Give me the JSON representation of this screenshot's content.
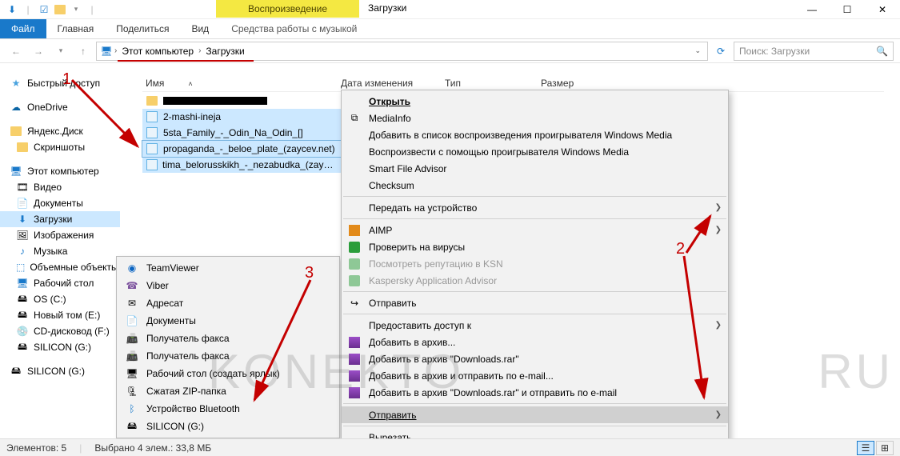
{
  "window": {
    "title": "Загрузки",
    "contextual_tab": "Воспроизведение",
    "contextual_tab2": "Средства работы с музыкой"
  },
  "ribbon": {
    "file": "Файл",
    "tabs": [
      "Главная",
      "Поделиться",
      "Вид"
    ]
  },
  "breadcrumb": {
    "pc": "Этот компьютер",
    "downloads": "Загрузки"
  },
  "search": {
    "placeholder": "Поиск: Загрузки"
  },
  "columns": {
    "name": "Имя",
    "date": "Дата изменения",
    "type": "Тип",
    "size": "Размер"
  },
  "sidebar": {
    "quick": "Быстрый доступ",
    "onedrive": "OneDrive",
    "ydisk": "Яндекс.Диск",
    "screens": "Скриншоты",
    "thispc": "Этот компьютер",
    "pcitems": [
      "Видео",
      "Документы",
      "Загрузки",
      "Изображения",
      "Музыка",
      "Объемные объекты",
      "Рабочий стол",
      "OS (C:)",
      "Новый том (E:)",
      "CD-дисковод (F:)",
      "SILICON (G:)"
    ],
    "silicon2": "SILICON (G:)"
  },
  "files": {
    "rows": [
      {
        "name": "2-mashi-ineja"
      },
      {
        "name": "5sta_Family_-_Odin_Na_Odin_[]"
      },
      {
        "name": "propaganda_-_beloe_plate_(zaycev.net)"
      },
      {
        "name": "tima_belorusskikh_-_nezabudka_(zaycev...)"
      }
    ]
  },
  "sendto": {
    "items": [
      "TeamViewer",
      "Viber",
      "Адресат",
      "Документы",
      "Получатель факса",
      "Получатель факса",
      "Рабочий стол (создать ярлык)",
      "Сжатая ZIP-папка",
      "Устройство Bluetooth",
      "SILICON (G:)"
    ]
  },
  "context": {
    "open": "Открыть",
    "mediainfo": "MediaInfo",
    "add_wmp_list": "Добавить в список воспроизведения проигрывателя Windows Media",
    "play_wmp": "Воспроизвести с помощью проигрывателя Windows Media",
    "sfa": "Smart File Advisor",
    "checksum": "Checksum",
    "cast": "Передать на устройство",
    "aimp": "AIMP",
    "scan": "Проверить на вирусы",
    "ksn": "Посмотреть репутацию в KSN",
    "kaa": "Kaspersky Application Advisor",
    "send": "Отправить",
    "share": "Предоставить доступ к",
    "rar_add": "Добавить в архив...",
    "rar_dl": "Добавить в архив \"Downloads.rar\"",
    "rar_mail": "Добавить в архив и отправить по e-mail...",
    "rar_dl_mail": "Добавить в архив \"Downloads.rar\" и отправить по e-mail",
    "send2": "Отправить",
    "cut": "Вырезать"
  },
  "status": {
    "count": "Элементов: 5",
    "sel": "Выбрано 4 элем.: 33,8 МБ"
  },
  "anno": {
    "n1": "1",
    "n2": "2",
    "n3": "3"
  },
  "wm": {
    "a": "KONEKTO",
    "b": "RU"
  }
}
